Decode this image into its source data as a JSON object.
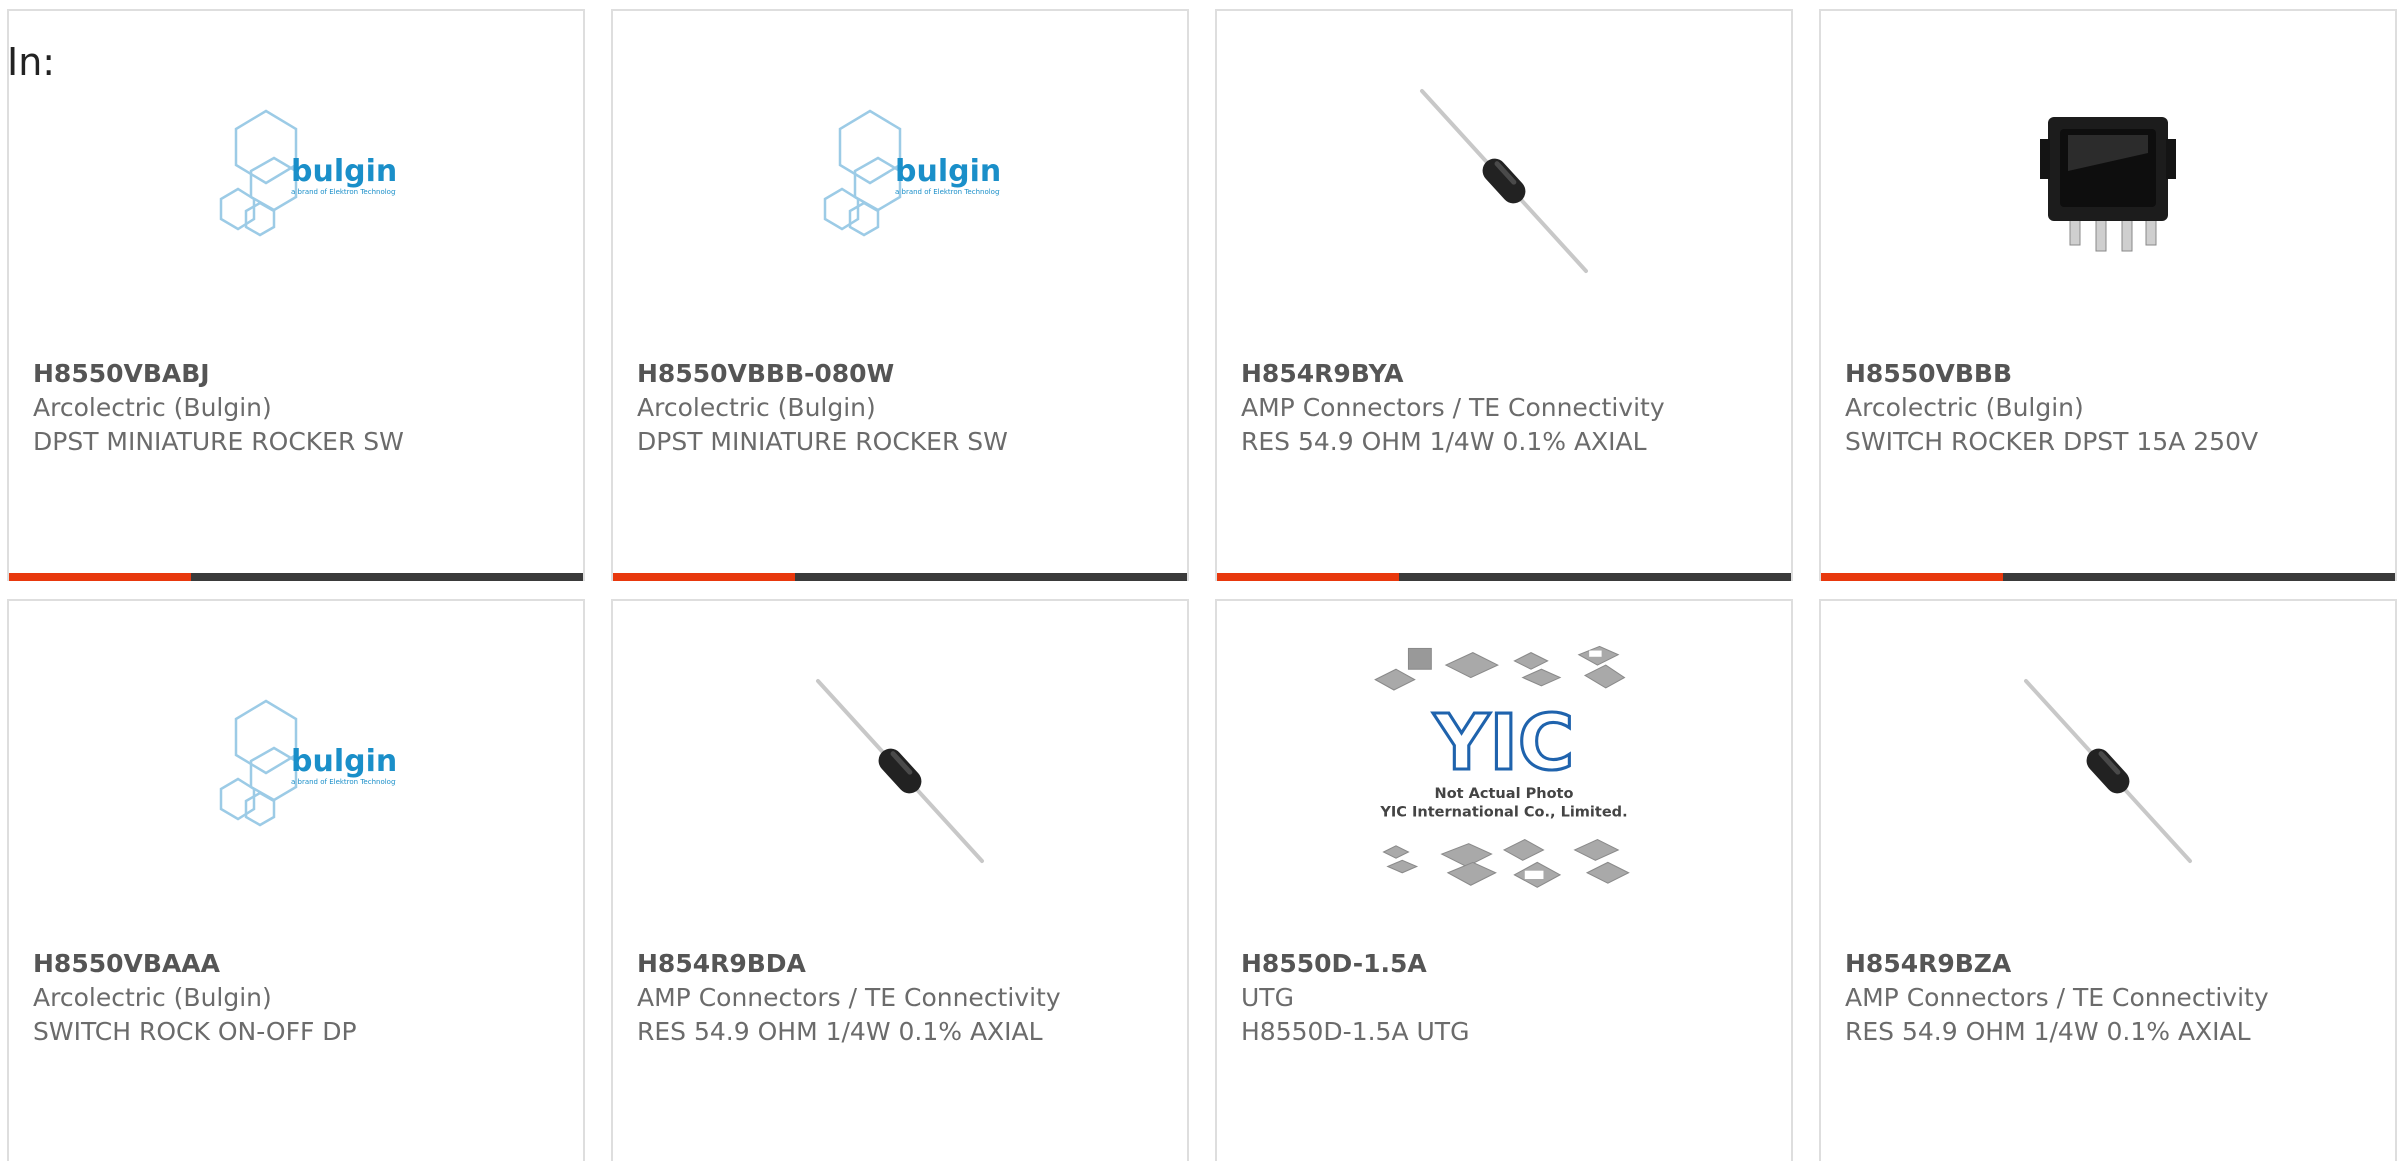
{
  "page": {
    "heading": "In:"
  },
  "products": [
    {
      "part": "H8550VBABJ",
      "maker": "Arcolectric (Bulgin)",
      "desc": "DPST MINIATURE ROCKER SW",
      "image": "bulgin-logo"
    },
    {
      "part": "H8550VBBB-080W",
      "maker": "Arcolectric (Bulgin)",
      "desc": "DPST MINIATURE ROCKER SW",
      "image": "bulgin-logo"
    },
    {
      "part": "H854R9BYA",
      "maker": "AMP Connectors / TE Connectivity",
      "desc": "RES 54.9 OHM 1/4W 0.1% AXIAL",
      "image": "axial-resistor"
    },
    {
      "part": "H8550VBBB",
      "maker": "Arcolectric (Bulgin)",
      "desc": "SWITCH ROCKER DPST 15A 250V",
      "image": "rocker-switch"
    },
    {
      "part": "H8550VBAAA",
      "maker": "Arcolectric (Bulgin)",
      "desc": "SWITCH ROCK ON-OFF DP",
      "image": "bulgin-logo"
    },
    {
      "part": "H854R9BDA",
      "maker": "AMP Connectors / TE Connectivity",
      "desc": "RES 54.9 OHM 1/4W 0.1% AXIAL",
      "image": "axial-resistor"
    },
    {
      "part": "H8550D-1.5A",
      "maker": "UTG",
      "desc": "H8550D-1.5A UTG",
      "image": "yic-placeholder"
    },
    {
      "part": "H854R9BZA",
      "maker": "AMP Connectors / TE Connectivity",
      "desc": "RES 54.9 OHM 1/4W 0.1% AXIAL",
      "image": "axial-resistor"
    }
  ],
  "logos": {
    "bulgin": {
      "name": "bulgin",
      "tagline": "a brand of Elektron Technology"
    },
    "yic": {
      "mark": "YIC",
      "line1": "Not Actual Photo",
      "line2": "YIC International Co., Limited."
    }
  },
  "colors": {
    "accent": "#e8380d",
    "bar": "#3a3a3a",
    "bulgin_blue": "#1a8fc9"
  }
}
